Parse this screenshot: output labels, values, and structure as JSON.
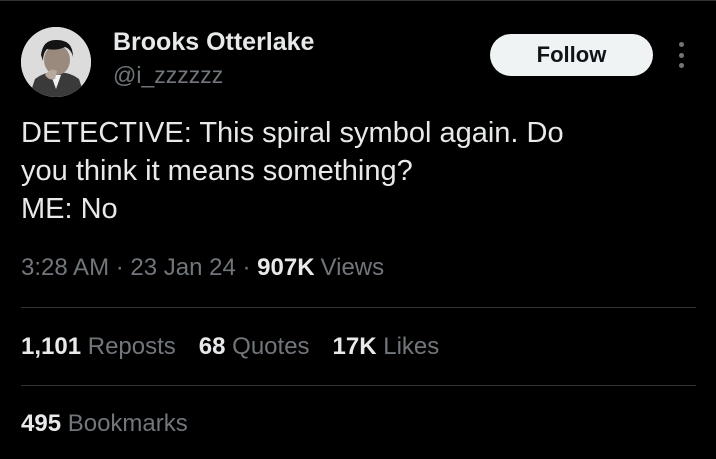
{
  "author": {
    "name": "Brooks Otterlake",
    "handle": "@i_zzzzzz",
    "avatar": "avatar-photo"
  },
  "follow_label": "Follow",
  "more_icon": "more-icon",
  "tweet": {
    "lines": [
      "DETECTIVE: This spiral symbol again. Do",
      "you think it means something?",
      "ME: No"
    ]
  },
  "meta": {
    "time": "3:28 AM",
    "sep1": "·",
    "date": "23 Jan 24",
    "sep2": "·",
    "views_count": "907K",
    "views_label": "Views"
  },
  "stats": {
    "reposts_count": "1,101",
    "reposts_label": "Reposts",
    "quotes_count": "68",
    "quotes_label": "Quotes",
    "likes_count": "17K",
    "likes_label": "Likes",
    "bookmarks_count": "495",
    "bookmarks_label": "Bookmarks"
  },
  "colors": {
    "background": "#000000",
    "text_primary": "#e7e9ea",
    "text_secondary": "#71767b",
    "divider": "#2f3336",
    "follow_bg": "#eff3f4"
  }
}
